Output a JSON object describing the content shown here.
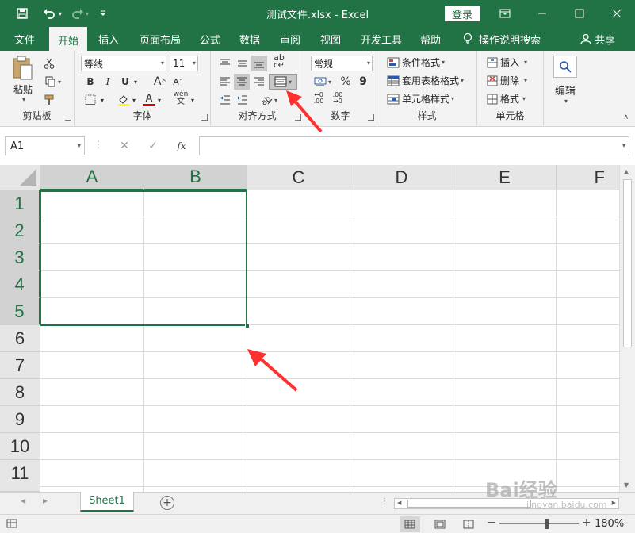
{
  "window": {
    "title": "测试文件.xlsx  -  Excel",
    "login_label": "登录",
    "accent": "#217346"
  },
  "quick_access": [
    {
      "icon": "save-icon"
    },
    {
      "icon": "undo-icon"
    },
    {
      "icon": "redo-icon"
    },
    {
      "icon": "customize-icon"
    }
  ],
  "menu": {
    "tabs": [
      "文件",
      "开始",
      "插入",
      "页面布局",
      "公式",
      "数据",
      "审阅",
      "视图",
      "开发工具",
      "帮助"
    ],
    "active_tab": "开始",
    "tell_me": "操作说明搜索",
    "share": "共享"
  },
  "ribbon": {
    "clipboard": {
      "label": "剪贴板",
      "paste": "粘贴"
    },
    "font": {
      "label": "字体",
      "font_name": "等线",
      "font_size": "11",
      "bold": "B",
      "italic": "I",
      "underline": "U",
      "grow": "A",
      "shrink": "A",
      "phonetic": "wén"
    },
    "alignment": {
      "label": "对齐方式",
      "wrap": "ab"
    },
    "number": {
      "label": "数字",
      "format": "常规",
      "percent": "%",
      "comma": "9",
      "inc_decimal": ".00",
      "dec_decimal": ".00"
    },
    "styles": {
      "label": "样式",
      "conditional": "条件格式",
      "table": "套用表格格式",
      "cell_styles": "单元格样式"
    },
    "cells": {
      "label": "单元格",
      "insert": "插入",
      "delete": "删除",
      "format": "格式"
    },
    "editing": {
      "label": "编辑"
    }
  },
  "formula_bar": {
    "name_box": "A1",
    "fx": "fx",
    "content": ""
  },
  "grid": {
    "columns": [
      "A",
      "B",
      "C",
      "D",
      "E",
      "F"
    ],
    "rows": [
      "1",
      "2",
      "3",
      "4",
      "5",
      "6",
      "7",
      "8",
      "9",
      "10",
      "11"
    ],
    "selected_range": "A1:B5"
  },
  "sheets": {
    "tabs": [
      "Sheet1"
    ],
    "active": "Sheet1"
  },
  "status": {
    "zoom": "180%",
    "zoom_minus": "−",
    "zoom_plus": "+"
  },
  "watermark": {
    "brand": "Bai经验",
    "sub": "jingyan.baidu.com"
  }
}
